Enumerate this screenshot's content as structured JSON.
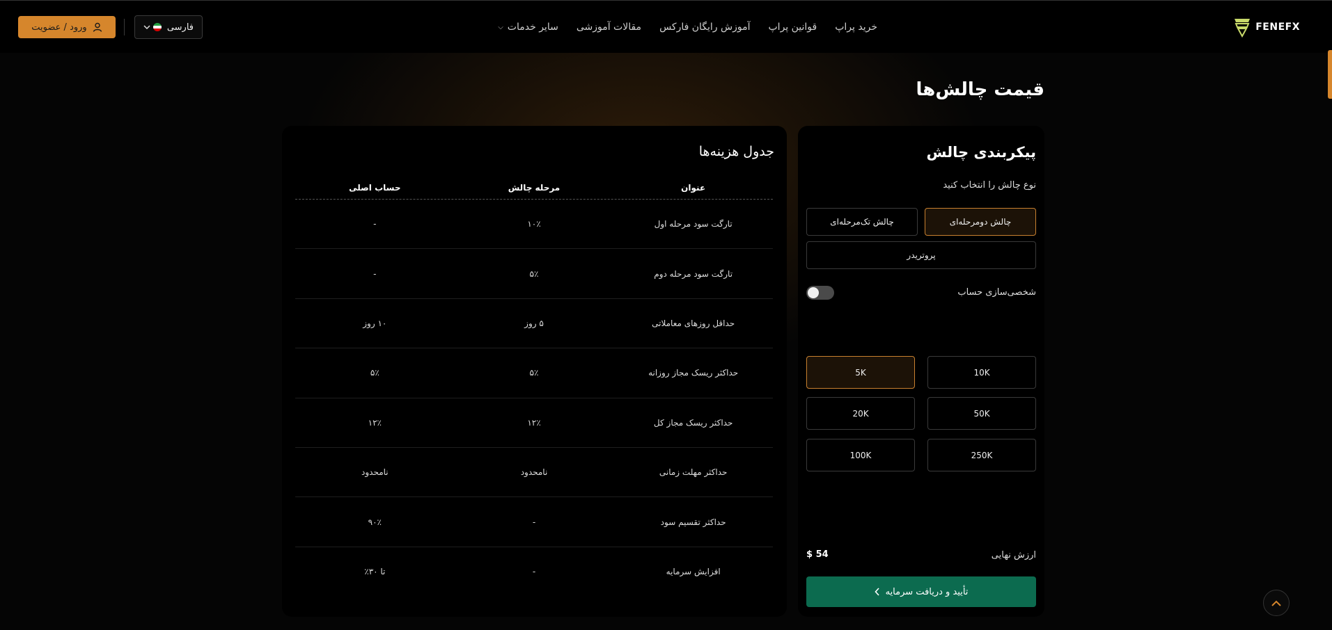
{
  "header": {
    "brand": "FENEFX",
    "nav": [
      {
        "label": "خرید پراپ",
        "has_dropdown": false
      },
      {
        "label": "قوانین پراپ",
        "has_dropdown": false
      },
      {
        "label": "آموزش رایگان فارکس",
        "has_dropdown": false
      },
      {
        "label": "مقالات آموزشی",
        "has_dropdown": false
      },
      {
        "label": "سایر خدمات",
        "has_dropdown": true
      }
    ],
    "language": "فارسی",
    "login_label": "ورود / عضویت"
  },
  "page_title": "قیمت چالش‌ها",
  "config": {
    "title": "پیکربندی چالش",
    "type_prompt": "نوع چالش را انتخاب کنید",
    "types": [
      {
        "label": "چالش دومرحله‌ای",
        "active": true
      },
      {
        "label": "چالش تک‌مرحله‌ای",
        "active": false
      },
      {
        "label": "پروتریدر",
        "active": false
      }
    ],
    "customize_label": "شخصی‌سازی حساب",
    "customize_on": false,
    "sizes": [
      {
        "label": "10K",
        "active": false
      },
      {
        "label": "5K",
        "active": true
      },
      {
        "label": "50K",
        "active": false
      },
      {
        "label": "20K",
        "active": false
      },
      {
        "label": "250K",
        "active": false
      },
      {
        "label": "100K",
        "active": false
      }
    ],
    "final_label": "ارزش نهایی",
    "final_value": "$ 54",
    "confirm_label": "تأیید و دریافت سرمایه"
  },
  "cost_table": {
    "title": "جدول هزینه‌ها",
    "headers": [
      "عنوان",
      "مرحله چالش",
      "حساب اصلی"
    ],
    "rows": [
      [
        "تارگت سود مرحله اول",
        "۱۰٪",
        "-"
      ],
      [
        "تارگت سود مرحله دوم",
        "۵٪",
        "-"
      ],
      [
        "حداقل روزهای معاملاتی",
        "۵ روز",
        "۱۰ روز"
      ],
      [
        "حداکثر ریسک مجاز روزانه",
        "۵٪",
        "۵٪"
      ],
      [
        "حداکثر ریسک مجاز کل",
        "۱۲٪",
        "۱۲٪"
      ],
      [
        "حداکثر مهلت زمانی",
        "نامحدود",
        "نامحدود"
      ],
      [
        "حداکثر تقسیم سود",
        "-",
        "۹۰٪"
      ],
      [
        "افزایش سرمایه",
        "-",
        "تا ۳۰٪"
      ]
    ]
  },
  "colors": {
    "accent": "#d6862c",
    "confirm": "#0c6b4f",
    "background": "#050505"
  }
}
